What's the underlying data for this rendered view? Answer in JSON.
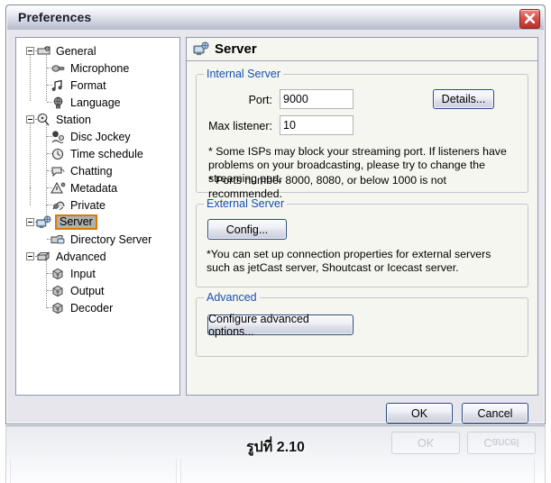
{
  "window": {
    "title": "Preferences",
    "close_icon": "close-icon",
    "close_label": "×"
  },
  "tree": {
    "items": [
      {
        "label": "General",
        "level": 0,
        "icon": "general-icon",
        "expanded": true,
        "selected": false
      },
      {
        "label": "Microphone",
        "level": 1,
        "icon": "microphone-icon",
        "expanded": false,
        "selected": false
      },
      {
        "label": "Format",
        "level": 1,
        "icon": "format-note-icon",
        "expanded": false,
        "selected": false
      },
      {
        "label": "Language",
        "level": 1,
        "icon": "language-globe-icon",
        "expanded": false,
        "selected": false
      },
      {
        "label": "Station",
        "level": 0,
        "icon": "station-antenna-icon",
        "expanded": true,
        "selected": false
      },
      {
        "label": "Disc Jockey",
        "level": 1,
        "icon": "disc-jockey-icon",
        "expanded": false,
        "selected": false
      },
      {
        "label": "Time schedule",
        "level": 1,
        "icon": "clock-icon",
        "expanded": false,
        "selected": false
      },
      {
        "label": "Chatting",
        "level": 1,
        "icon": "chat-icon",
        "expanded": false,
        "selected": false
      },
      {
        "label": "Metadata",
        "level": 1,
        "icon": "metadata-tag-icon",
        "expanded": false,
        "selected": false
      },
      {
        "label": "Private",
        "level": 1,
        "icon": "private-lock-icon",
        "expanded": false,
        "selected": false
      },
      {
        "label": "Server",
        "level": 0,
        "icon": "server-monitor-icon",
        "expanded": true,
        "selected": true
      },
      {
        "label": "Directory Server",
        "level": 1,
        "icon": "directory-server-icon",
        "expanded": false,
        "selected": false
      },
      {
        "label": "Advanced",
        "level": 0,
        "icon": "advanced-box-icon",
        "expanded": true,
        "selected": false
      },
      {
        "label": "Input",
        "level": 1,
        "icon": "input-cube-icon",
        "expanded": false,
        "selected": false
      },
      {
        "label": "Output",
        "level": 1,
        "icon": "output-cube-icon",
        "expanded": false,
        "selected": false
      },
      {
        "label": "Decoder",
        "level": 1,
        "icon": "decoder-cube-icon",
        "expanded": false,
        "selected": false
      }
    ]
  },
  "content": {
    "header_title": "Server",
    "header_icon": "server-monitor-icon",
    "internal": {
      "legend": "Internal Server",
      "port_label": "Port:",
      "port_value": "9000",
      "max_listener_label": "Max listener:",
      "max_listener_value": "10",
      "details_button": "Details...",
      "note1": "* Some ISPs may block your streaming port. If listeners have problems on your broadcasting, please try to change the streaming port.",
      "note2": "* Ports number 8000, 8080, or below 1000 is not recommended."
    },
    "external": {
      "legend": "External Server",
      "config_button": "Config...",
      "note": "*You can set up connection properties for external servers such as jetCast server, Shoutcast or Icecast server."
    },
    "advanced": {
      "legend": "Advanced",
      "configure_button": "Configure advanced options..."
    }
  },
  "footer": {
    "ok_label": "OK",
    "cancel_label": "Cancel"
  },
  "reflection": {
    "ok_label": "OK",
    "cancel_label": "Cancel"
  },
  "caption": {
    "text": "รูปที่ 2.10"
  },
  "colors": {
    "legend_blue": "#1450b4",
    "selection_border": "#e07800",
    "selection_bg": "#b0b0b0",
    "close_red": "#d4534c",
    "button_border": "#2b4b84"
  }
}
